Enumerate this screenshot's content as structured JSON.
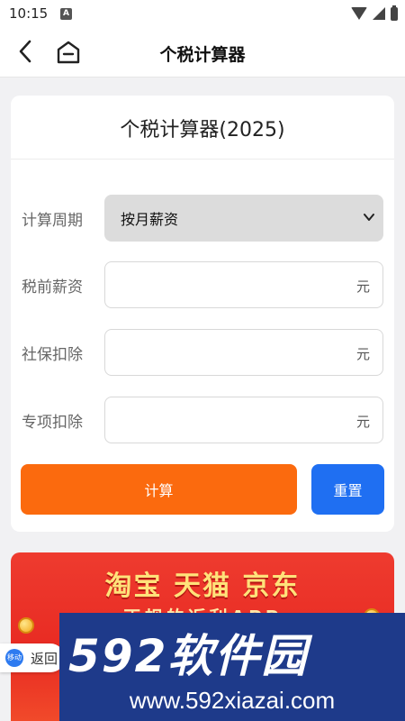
{
  "status_bar": {
    "time": "10:15",
    "notification_icon": "A"
  },
  "header": {
    "title": "个税计算器",
    "back_icon": "chevron-left-icon",
    "home_icon": "home-icon"
  },
  "calculator": {
    "title": "个税计算器(2025)",
    "period_label": "计算周期",
    "period_value": "按月薪资",
    "pretax_label": "税前薪资",
    "social_label": "社保扣除",
    "special_label": "专项扣除",
    "unit": "元",
    "calc_button": "计算",
    "reset_button": "重置",
    "colors": {
      "calc_button": "#fb6a0e",
      "reset_button": "#1f6ff2"
    }
  },
  "banner": {
    "title": "淘宝 天猫 京东",
    "subtitle": "正规的返利APP"
  },
  "back_pill": {
    "logo": "移动",
    "label": "返回"
  },
  "watermark": {
    "brand": "592软件园",
    "url": "www.592xiazai.com"
  }
}
